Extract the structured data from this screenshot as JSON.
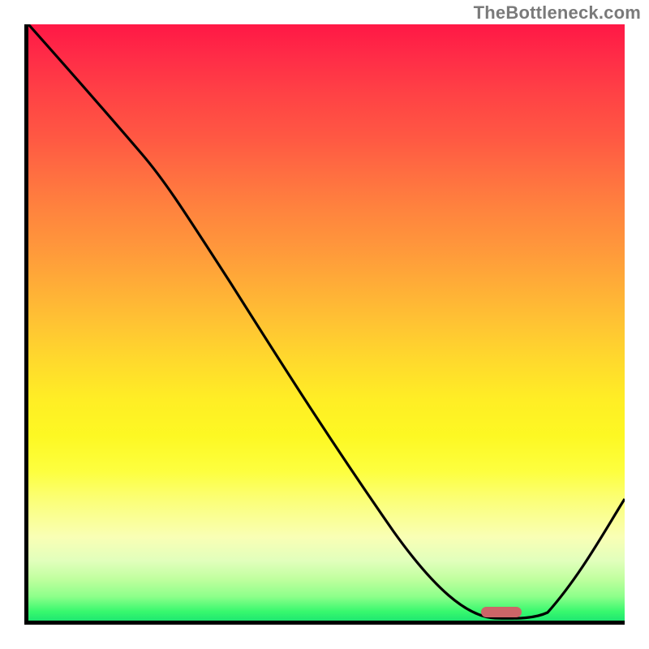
{
  "attribution": "TheBottleneck.com",
  "chart_data": {
    "type": "line",
    "title": "",
    "xlabel": "",
    "ylabel": "",
    "xlim": [
      0,
      100
    ],
    "ylim": [
      0,
      100
    ],
    "series": [
      {
        "name": "bottleneck-curve",
        "x": [
          0,
          12,
          24,
          36,
          48,
          60,
          72,
          80,
          88,
          100
        ],
        "values": [
          100,
          87,
          74,
          56,
          38,
          20,
          4,
          0,
          0,
          20
        ]
      }
    ],
    "marker": {
      "name": "optimal-range",
      "x_start": 78,
      "x_end": 85,
      "y": 0
    },
    "background_gradient": {
      "type": "vertical",
      "stops": [
        {
          "pos": 0.0,
          "color": "#ff1846"
        },
        {
          "pos": 0.5,
          "color": "#ffc333"
        },
        {
          "pos": 0.75,
          "color": "#fdff3f"
        },
        {
          "pos": 0.93,
          "color": "#c1ff9f"
        },
        {
          "pos": 1.0,
          "color": "#1fe770"
        }
      ]
    }
  }
}
